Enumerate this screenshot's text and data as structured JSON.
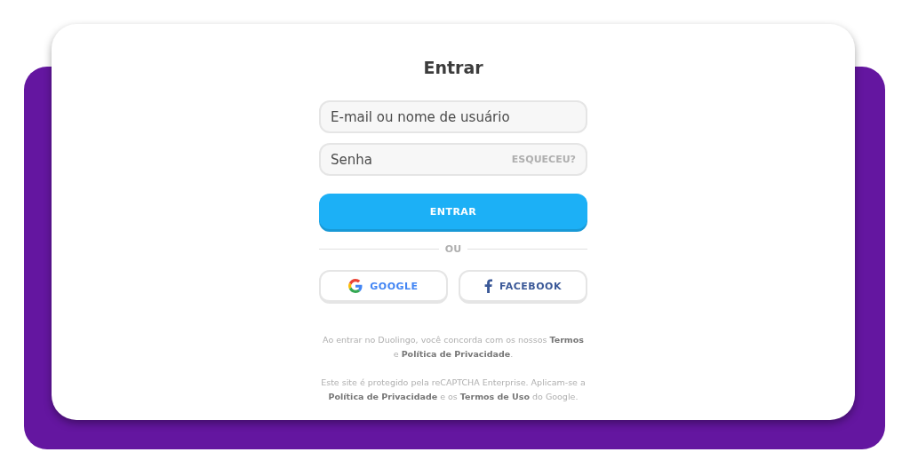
{
  "title": "Entrar",
  "email_field": {
    "placeholder": "E-mail ou nome de usuário"
  },
  "password_field": {
    "placeholder": "Senha",
    "forgot_link": "ESQUECEU?"
  },
  "submit_button": "ENTRAR",
  "divider_label": "OU",
  "social_buttons": [
    {
      "kind": "google",
      "label": "GOOGLE"
    },
    {
      "kind": "facebook",
      "label": "FACEBOOK"
    }
  ],
  "legal_texts": [
    "Ao entrar no Duolingo, você concorda com os nossos **Termos** e **Política de Privacidade**.",
    "Este site é protegido pela reCAPTCHA Enterprise. Aplicam-se a **Política de Privacidade** e os **Termos de Uso** do Google."
  ]
}
